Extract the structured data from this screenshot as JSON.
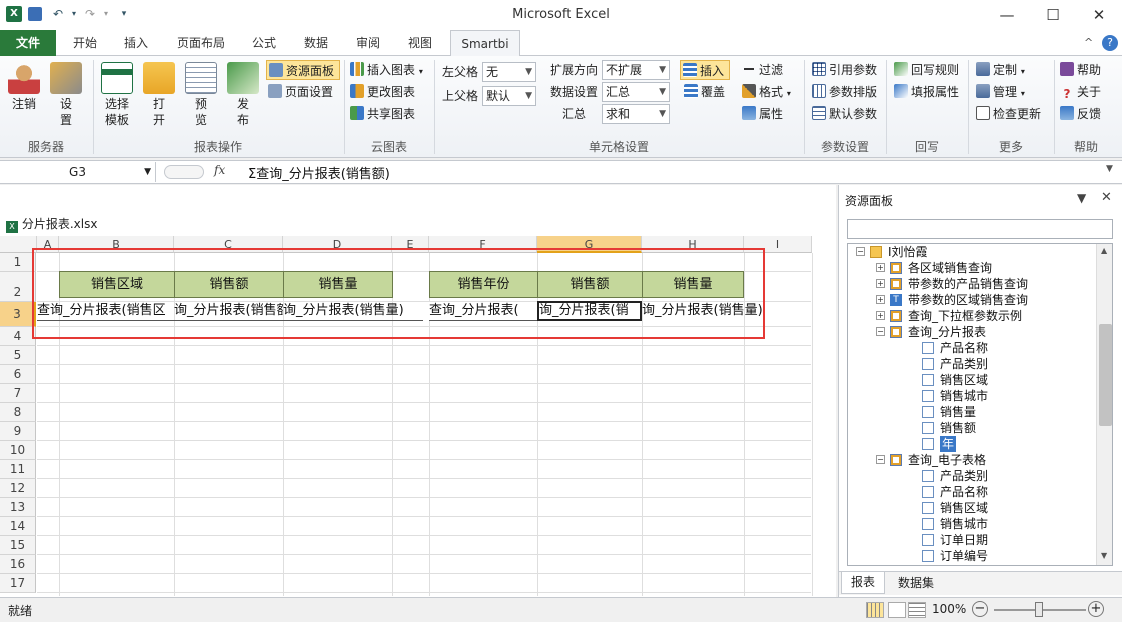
{
  "app": {
    "title": "Microsoft Excel"
  },
  "tabs": [
    "文件",
    "开始",
    "插入",
    "页面布局",
    "公式",
    "数据",
    "审阅",
    "视图",
    "Smartbi"
  ],
  "ribbon": {
    "groups": {
      "server": {
        "label": "服务器",
        "logout": "注销",
        "settings": "设\n置"
      },
      "report_ops": {
        "label": "报表操作",
        "select_template": "选择\n模板",
        "open": "打\n开",
        "preview": "预\n览",
        "publish": "发\n布",
        "resource_panel": "资源面板",
        "page_setup": "页面设置"
      },
      "cloud_chart": {
        "label": "云图表",
        "insert_chart": "插入图表",
        "change_chart": "更改图表",
        "share_chart": "共享图表"
      },
      "cell_settings": {
        "label": "单元格设置",
        "left_parent": "左父格",
        "left_parent_value": "无",
        "top_parent": "上父格",
        "top_parent_value": "默认",
        "expand_dir": "扩展方向",
        "expand_dir_value": "不扩展",
        "data_setting": "数据设置",
        "data_setting_value": "汇总",
        "summary": "汇总",
        "summary_value": "求和",
        "insert": "插入",
        "cover": "覆盖",
        "filter": "过滤",
        "format": "格式",
        "attr": "属性"
      },
      "params": {
        "label": "参数设置",
        "ref_param": "引用参数",
        "param_layout": "参数排版",
        "default_param": "默认参数"
      },
      "writeback": {
        "label": "回写",
        "rules": "回写规则",
        "fill_attr": "填报属性"
      },
      "more": {
        "label": "更多",
        "custom": "定制",
        "manage": "管理",
        "check_update": "检查更新"
      },
      "help": {
        "label": "帮助",
        "help": "帮助",
        "about": "关于",
        "feedback": "反馈"
      }
    }
  },
  "formula_bar": {
    "name_box": "G3",
    "fx": "fx",
    "formula": "Σ查询_分片报表(销售额)"
  },
  "workbook": {
    "filename": "分片报表.xlsx",
    "columns": [
      "A",
      "B",
      "C",
      "D",
      "E",
      "F",
      "G",
      "H",
      "I"
    ],
    "rows": [
      "1",
      "2",
      "3",
      "4",
      "5",
      "6",
      "7",
      "8",
      "9",
      "10",
      "11",
      "12",
      "13",
      "14",
      "15",
      "16",
      "17"
    ],
    "headers_left": [
      "销售区域",
      "销售额",
      "销售量"
    ],
    "headers_right": [
      "销售年份",
      "销售额",
      "销售量"
    ],
    "data_row": [
      "查询_分片报表(销售区",
      "询_分片报表(销售额",
      "询_分片报表(销售量)",
      "查询_分片报表(",
      "询_分片报表(销",
      "询_分片报表(销售量)"
    ]
  },
  "resource_panel": {
    "title": "资源面板",
    "tree": [
      {
        "label": "I刘怡霞",
        "level": 0,
        "type": "folder"
      },
      {
        "label": "各区域销售查询",
        "level": 1,
        "type": "query"
      },
      {
        "label": "带参数的产品销售查询",
        "level": 1,
        "type": "query"
      },
      {
        "label": "带参数的区域销售查询",
        "level": 1,
        "type": "text"
      },
      {
        "label": "查询_下拉框参数示例",
        "level": 1,
        "type": "query"
      },
      {
        "label": "查询_分片报表",
        "level": 1,
        "type": "query"
      },
      {
        "label": "产品名称",
        "level": 2,
        "type": "field"
      },
      {
        "label": "产品类别",
        "level": 2,
        "type": "field"
      },
      {
        "label": "销售区域",
        "level": 2,
        "type": "field"
      },
      {
        "label": "销售城市",
        "level": 2,
        "type": "field"
      },
      {
        "label": "销售量",
        "level": 2,
        "type": "field"
      },
      {
        "label": "销售额",
        "level": 2,
        "type": "field"
      },
      {
        "label": "年",
        "level": 2,
        "type": "field",
        "selected": true
      },
      {
        "label": "查询_电子表格",
        "level": 1,
        "type": "query"
      },
      {
        "label": "产品类别",
        "level": 2,
        "type": "field"
      },
      {
        "label": "产品名称",
        "level": 2,
        "type": "field"
      },
      {
        "label": "销售区域",
        "level": 2,
        "type": "field"
      },
      {
        "label": "销售城市",
        "level": 2,
        "type": "field"
      },
      {
        "label": "订单日期",
        "level": 2,
        "type": "field"
      },
      {
        "label": "订单编号",
        "level": 2,
        "type": "field"
      }
    ],
    "bottom_tabs": [
      "报表",
      "数据集"
    ]
  },
  "status": {
    "ready": "就绪",
    "zoom": "100%"
  },
  "colors": {
    "file_tab": "#2a7a3a",
    "header_fill": "#c4d79b",
    "highlight": "#e53935",
    "selected_col": "#f7d28a"
  }
}
